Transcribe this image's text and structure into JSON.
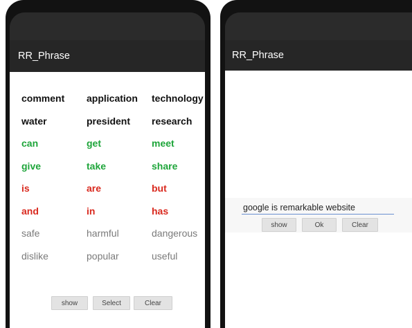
{
  "left_phone": {
    "app_title": "RR_Phrase",
    "word_grid": [
      [
        {
          "text": "comment",
          "color": "black"
        },
        {
          "text": "application",
          "color": "black"
        },
        {
          "text": "technology",
          "color": "black"
        }
      ],
      [
        {
          "text": "water",
          "color": "black"
        },
        {
          "text": "president",
          "color": "black"
        },
        {
          "text": "research",
          "color": "black"
        }
      ],
      [
        {
          "text": "can",
          "color": "green"
        },
        {
          "text": "get",
          "color": "green"
        },
        {
          "text": "meet",
          "color": "green"
        }
      ],
      [
        {
          "text": "give",
          "color": "green"
        },
        {
          "text": "take",
          "color": "green"
        },
        {
          "text": "share",
          "color": "green"
        }
      ],
      [
        {
          "text": "is",
          "color": "red"
        },
        {
          "text": "are",
          "color": "red"
        },
        {
          "text": "but",
          "color": "red"
        }
      ],
      [
        {
          "text": "and",
          "color": "red"
        },
        {
          "text": "in",
          "color": "red"
        },
        {
          "text": "has",
          "color": "red"
        }
      ],
      [
        {
          "text": "safe",
          "color": "gray"
        },
        {
          "text": "harmful",
          "color": "gray"
        },
        {
          "text": "dangerous",
          "color": "gray"
        }
      ],
      [
        {
          "text": "dislike",
          "color": "gray"
        },
        {
          "text": "popular",
          "color": "gray"
        },
        {
          "text": "useful",
          "color": "gray"
        }
      ]
    ],
    "buttons": {
      "show": "show",
      "select": "Select",
      "clear": "Clear"
    }
  },
  "right_phone": {
    "app_title": "RR_Phrase",
    "input_value": "google is remarkable website",
    "buttons": {
      "show": "show",
      "ok": "Ok",
      "clear": "Clear"
    }
  },
  "colors": {
    "black": "#111111",
    "green": "#1ea53a",
    "red": "#d9291e",
    "gray": "#7a7a7a",
    "app_bar": "#262626",
    "button_bg": "#e3e3e3",
    "input_underline": "#6a8fd0"
  }
}
